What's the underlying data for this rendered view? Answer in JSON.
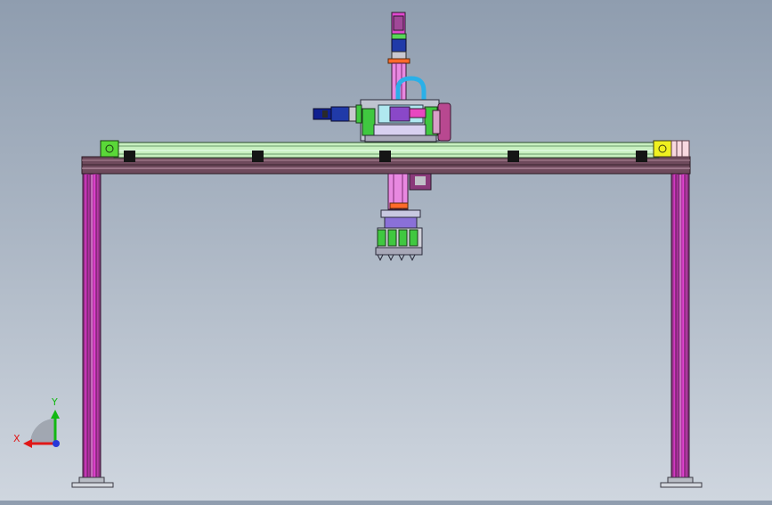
{
  "viewport": {
    "background_top": "#8f9daf",
    "background_bottom": "#cfd6df"
  },
  "triad": {
    "x_label": "X",
    "y_label": "Y",
    "x_color": "#e01818",
    "y_color": "#12b812",
    "z_color": "#2838d8"
  },
  "model": {
    "frame_color": "#e020c8",
    "beam_color": "#6e4a5c",
    "rail_color": "#c8f0c0",
    "motor_color": "#b84890"
  }
}
